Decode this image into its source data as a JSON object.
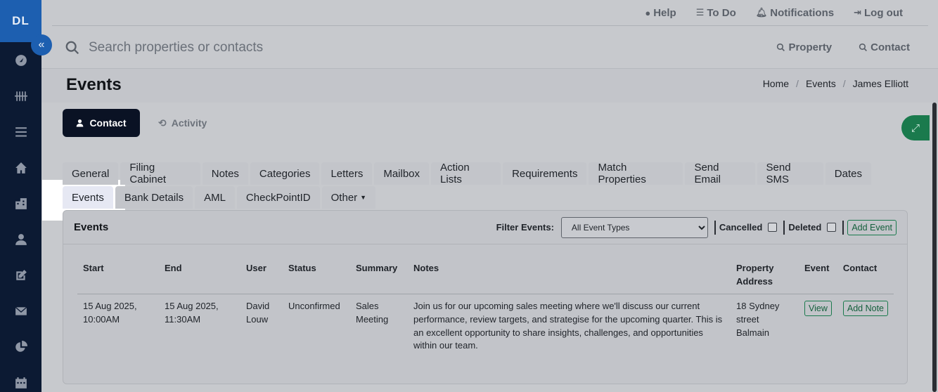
{
  "sidebar": {
    "brand": "DL",
    "items": [
      "dashboard-icon",
      "tally-icon",
      "menu-icon",
      "home-icon",
      "building-icon",
      "user-icon",
      "edit-icon",
      "mail-icon",
      "chart-pie-icon",
      "calendar-icon"
    ]
  },
  "topbar": {
    "help": "Help",
    "todo": "To Do",
    "notifications": "Notifications",
    "logout": "Log out"
  },
  "search": {
    "placeholder": "Search properties or contacts",
    "property": "Property",
    "contact": "Contact"
  },
  "page": {
    "title": "Events",
    "breadcrumb": [
      "Home",
      "Events",
      "James Elliott"
    ]
  },
  "tabs": {
    "contact": "Contact",
    "activity": "Activity"
  },
  "subtabs": {
    "row1": [
      "General",
      "Filing Cabinet",
      "Notes",
      "Categories",
      "Letters",
      "Mailbox",
      "Action Lists",
      "Requirements",
      "Match Properties",
      "Send Email",
      "Send SMS",
      "Dates"
    ],
    "row2": [
      "Events",
      "Bank Details",
      "AML",
      "CheckPointID"
    ],
    "other": "Other"
  },
  "events": {
    "title": "Events",
    "filter_label": "Filter Events:",
    "filter_value": "All Event Types",
    "cancelled": "Cancelled",
    "deleted": "Deleted",
    "add_event": "Add Event",
    "columns": [
      "Start",
      "End",
      "User",
      "Status",
      "Summary",
      "Notes",
      "Property Address",
      "Event",
      "Contact"
    ],
    "rows": [
      {
        "start": "15 Aug 2025, 10:00AM",
        "end": "15 Aug 2025, 11:30AM",
        "user": "David Louw",
        "status": "Unconfirmed",
        "summary": "Sales Meeting",
        "notes": "Join us for our upcoming sales meeting where we'll discuss our current performance, review targets, and strategise for the upcoming quarter. This is an excellent opportunity to share insights, challenges, and opportunities within our team.",
        "address": "18 Sydney street Balmain",
        "view": "View",
        "add_note": "Add Note"
      }
    ]
  }
}
